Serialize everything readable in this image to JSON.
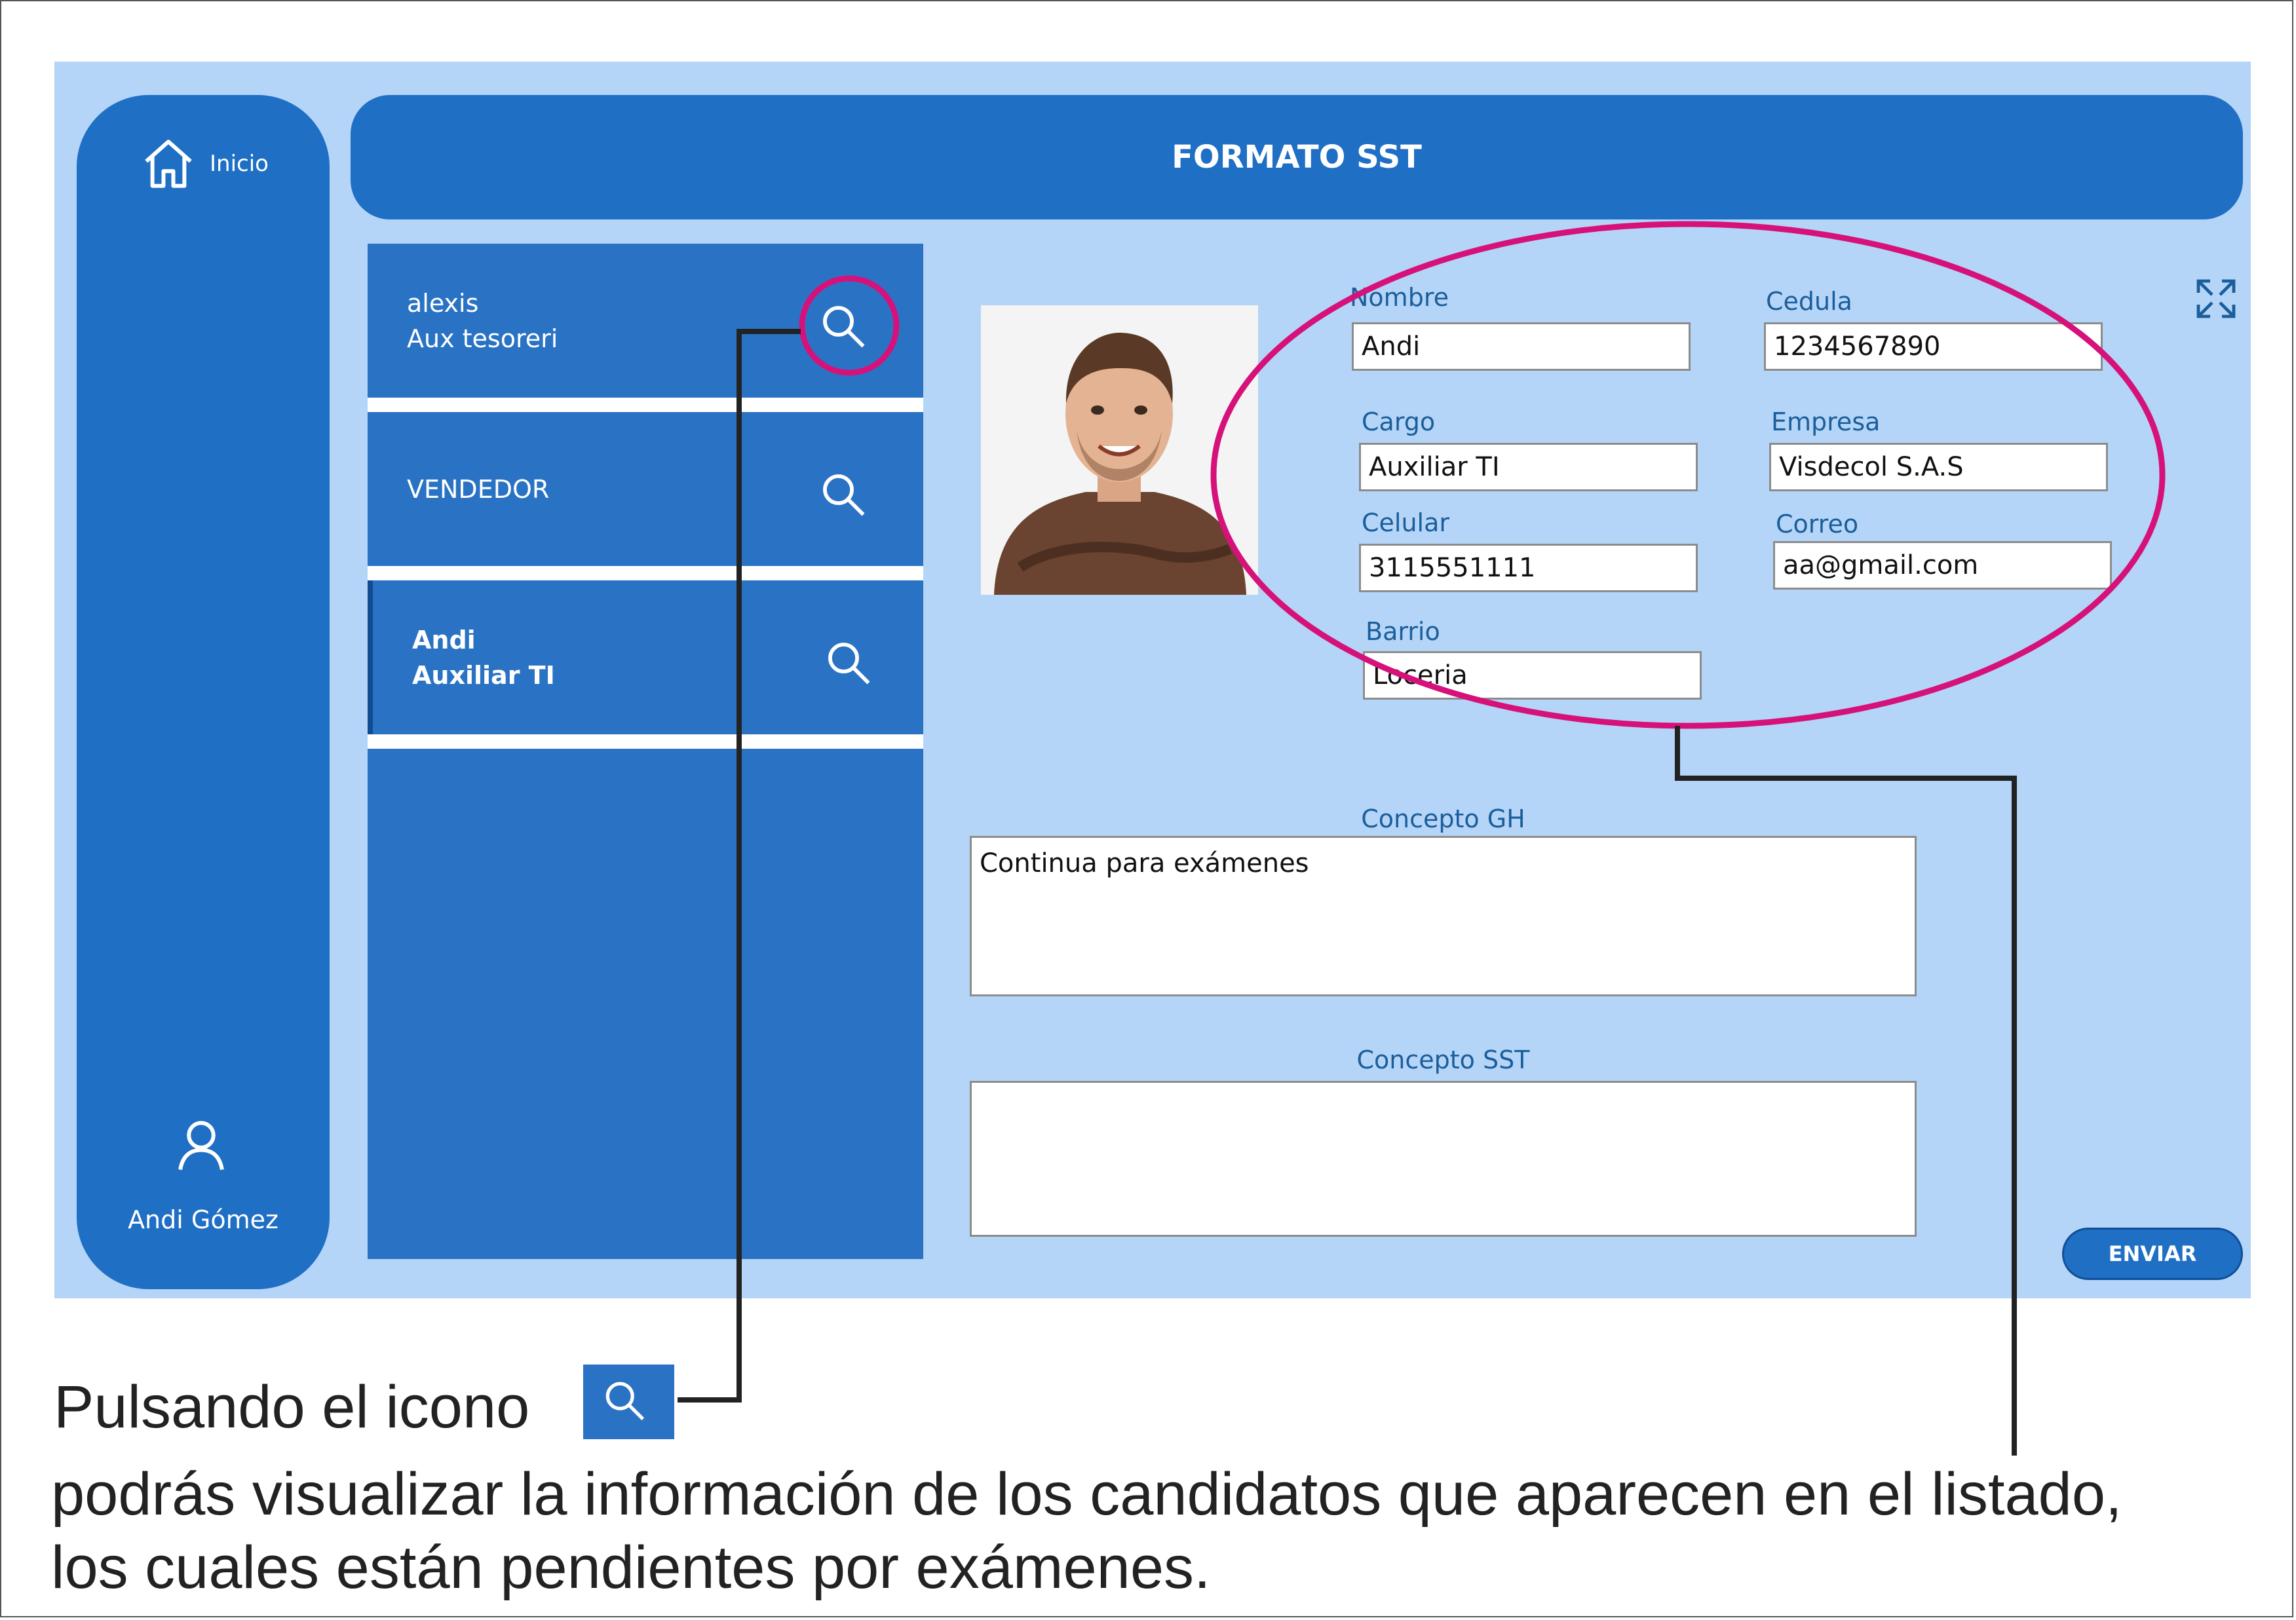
{
  "sidebar": {
    "home_label": "Inicio",
    "home_icon": "home-icon",
    "user_icon": "user-icon",
    "user_name": "Andi Gómez"
  },
  "header": {
    "title": "FORMATO SST"
  },
  "list": {
    "items": [
      {
        "line1": "alexis",
        "line2": "Aux tesoreri",
        "icon": "search-icon",
        "selected": false
      },
      {
        "line1": "VENDEDOR",
        "line2": "",
        "icon": "search-icon",
        "selected": false
      },
      {
        "line1": "Andi",
        "line2": "Auxiliar TI",
        "icon": "search-icon",
        "selected": true
      }
    ]
  },
  "form": {
    "nombre": {
      "label": "Nombre",
      "value": "Andi"
    },
    "cedula": {
      "label": "Cedula",
      "value": "1234567890"
    },
    "cargo": {
      "label": "Cargo",
      "value": "Auxiliar TI"
    },
    "empresa": {
      "label": "Empresa",
      "value": "Visdecol S.A.S"
    },
    "celular": {
      "label": "Celular",
      "value": "3115551111"
    },
    "correo": {
      "label": "Correo",
      "value": "aa@gmail.com"
    },
    "barrio": {
      "label": "Barrio",
      "value": "Loceria"
    },
    "concepto_gh": {
      "label": "Concepto GH",
      "value": "Continua para exámenes"
    },
    "concepto_sst": {
      "label": "Concepto SST",
      "value": ""
    },
    "send_label": "ENVIAR",
    "expand_icon": "expand-icon"
  },
  "annotation": {
    "line1": "Pulsando el icono",
    "line2": "podrás visualizar la información de los candidatos que aparecen en el listado, los cuales están pendientes por exámenes.",
    "highlight_color": "#d6127a",
    "connector_color": "#222222"
  }
}
